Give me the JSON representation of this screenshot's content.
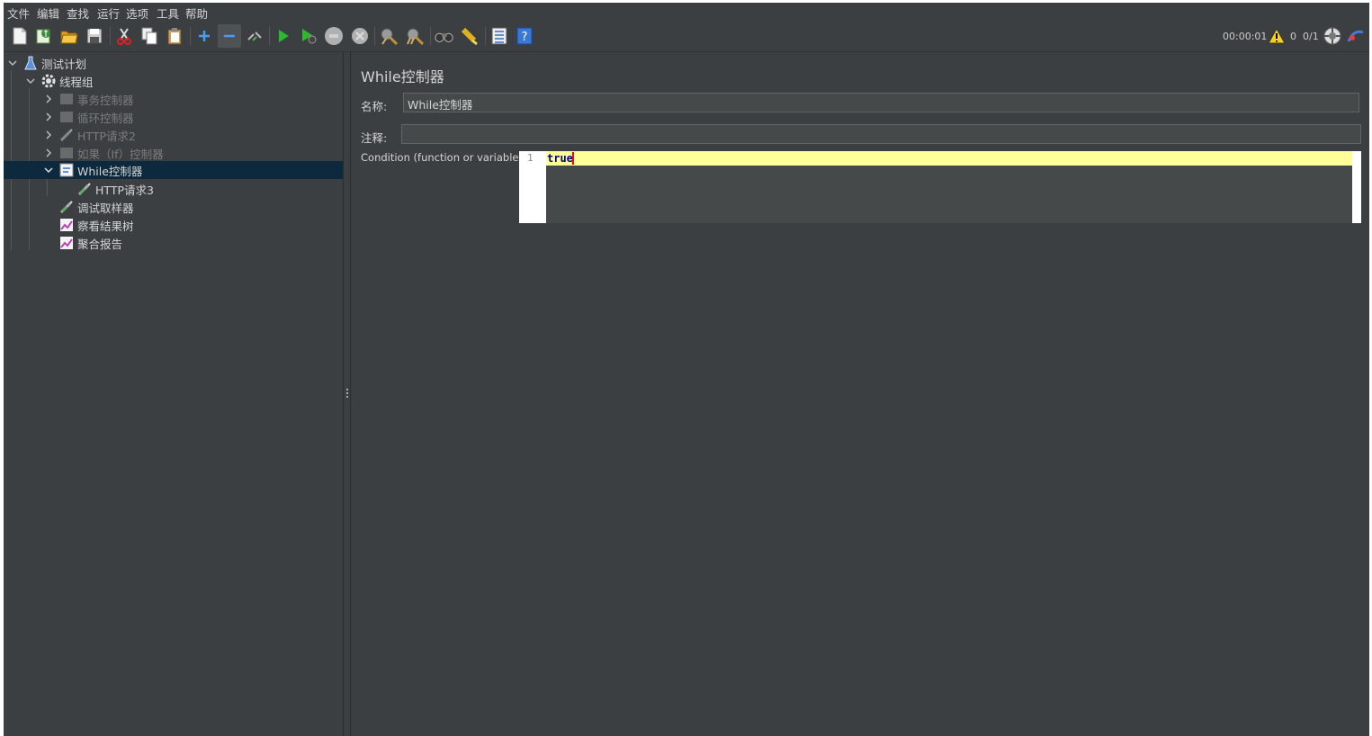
{
  "menu": [
    "文件",
    "编辑",
    "查找",
    "运行",
    "选项",
    "工具",
    "帮助"
  ],
  "toolbar": {
    "timer": "00:00:01",
    "warning_count": "0",
    "threads": "0/1"
  },
  "tree": {
    "root": "测试计划",
    "thread_group": "线程组",
    "items": [
      {
        "label": "事务控制器",
        "disabled": true
      },
      {
        "label": "循环控制器",
        "disabled": true
      },
      {
        "label": "HTTP请求2",
        "disabled": true
      },
      {
        "label": "如果（If）控制器",
        "disabled": true
      },
      {
        "label": "While控制器",
        "selected": true
      },
      {
        "label": "HTTP请求3"
      },
      {
        "label": "调试取样器"
      },
      {
        "label": "察看结果树"
      },
      {
        "label": "聚合报告"
      }
    ]
  },
  "panel": {
    "title": "While控制器",
    "name_label": "名称:",
    "name_value": "While控制器",
    "comment_label": "注释:",
    "comment_value": "",
    "condition_label": "Condition (function or variable)",
    "line_number": "1",
    "condition_value": "true"
  },
  "colors": {
    "background": "#3c3f41",
    "selection": "#0d293e",
    "current_line": "#ffff99",
    "keyword": "#000080"
  }
}
